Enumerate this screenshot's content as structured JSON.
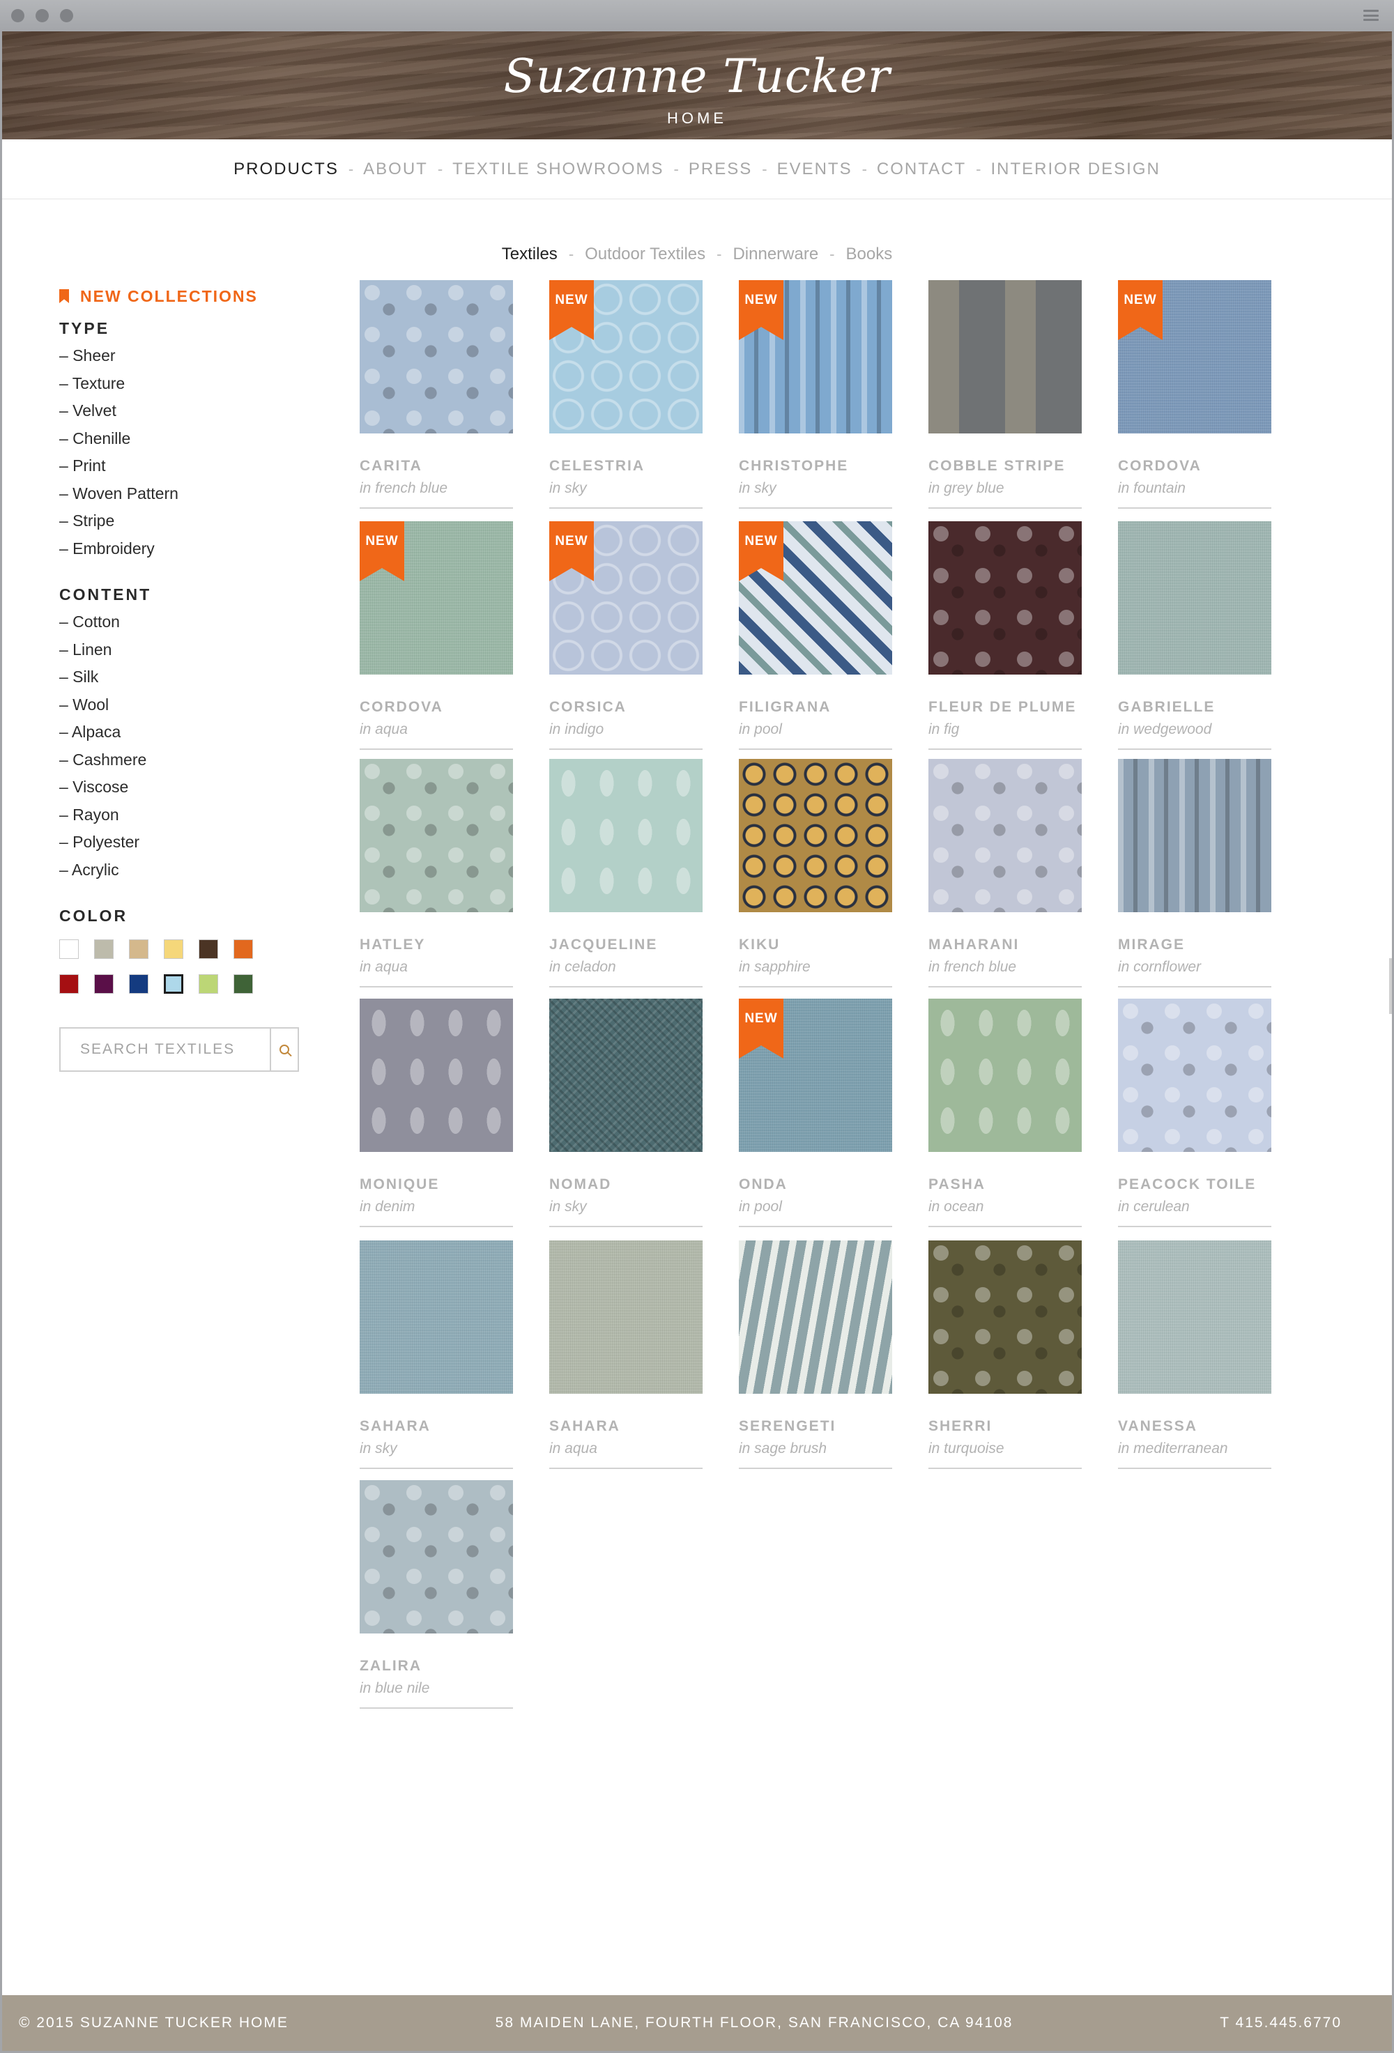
{
  "brand": {
    "script": "Suzanne Tucker",
    "sub": "HOME"
  },
  "nav": [
    {
      "label": "PRODUCTS",
      "active": true
    },
    {
      "label": "ABOUT"
    },
    {
      "label": "TEXTILE SHOWROOMS"
    },
    {
      "label": "PRESS"
    },
    {
      "label": "EVENTS"
    },
    {
      "label": "CONTACT"
    },
    {
      "label": "INTERIOR DESIGN"
    }
  ],
  "nav_separator": "-",
  "subnav": [
    {
      "label": "Textiles",
      "active": true
    },
    {
      "label": "Outdoor Textiles"
    },
    {
      "label": "Dinnerware"
    },
    {
      "label": "Books"
    }
  ],
  "sidebar": {
    "new_collections": "NEW COLLECTIONS",
    "type_heading": "TYPE",
    "types": [
      "– Sheer",
      "– Texture",
      "– Velvet",
      "– Chenille",
      "– Print",
      "– Woven Pattern",
      "– Stripe",
      "– Embroidery"
    ],
    "content_heading": "CONTENT",
    "contents": [
      "– Cotton",
      "– Linen",
      "– Silk",
      "– Wool",
      "– Alpaca",
      "– Cashmere",
      "– Viscose",
      "– Rayon",
      "– Polyester",
      "– Acrylic"
    ],
    "color_heading": "COLOR",
    "colors": [
      "#ffffff",
      "#bdbbab",
      "#d4b88c",
      "#f5d77a",
      "#4b3424",
      "#e2681e",
      "#a50f12",
      "#5a0f48",
      "#143b80",
      "#aed8ea",
      "#bcd676",
      "#3f6337"
    ],
    "selected_color_index": 9,
    "search_placeholder": "SEARCH TEXTILES"
  },
  "badge_label": "NEW",
  "products": [
    {
      "name": "CARITA",
      "color": "in french blue",
      "is_new": false,
      "swatch": "#a9bdd3",
      "pattern": "floral"
    },
    {
      "name": "CELESTRIA",
      "color": "in sky",
      "is_new": true,
      "swatch": "#a7cce0",
      "pattern": "medallion"
    },
    {
      "name": "CHRISTOPHE",
      "color": "in sky",
      "is_new": true,
      "swatch": "#7fa9cf",
      "pattern": "stripe"
    },
    {
      "name": "COBBLE STRIPE",
      "color": "in grey blue",
      "is_new": false,
      "swatch": "#6f7274",
      "pattern": "wide-stripe"
    },
    {
      "name": "CORDOVA",
      "color": "in fountain",
      "is_new": true,
      "swatch": "#7b98b8",
      "pattern": "texture"
    },
    {
      "name": "CORDOVA",
      "color": "in aqua",
      "is_new": true,
      "swatch": "#9ab7a6",
      "pattern": "texture"
    },
    {
      "name": "CORSICA",
      "color": "in indigo",
      "is_new": true,
      "swatch": "#b8c4da",
      "pattern": "medallion"
    },
    {
      "name": "FILIGRANA",
      "color": "in pool",
      "is_new": true,
      "swatch": "#5c7ea2",
      "pattern": "ikat"
    },
    {
      "name": "FLEUR DE PLUME",
      "color": "in fig",
      "is_new": false,
      "swatch": "#4a2a2c",
      "pattern": "floral"
    },
    {
      "name": "GABRIELLE",
      "color": "in wedgewood",
      "is_new": false,
      "swatch": "#9eb5b1",
      "pattern": "texture"
    },
    {
      "name": "HATLEY",
      "color": "in aqua",
      "is_new": false,
      "swatch": "#aec3b8",
      "pattern": "floral"
    },
    {
      "name": "JACQUELINE",
      "color": "in celadon",
      "is_new": false,
      "swatch": "#b3d0c8",
      "pattern": "damask"
    },
    {
      "name": "KIKU",
      "color": "in sapphire",
      "is_new": false,
      "swatch": "#b08a46",
      "pattern": "dots"
    },
    {
      "name": "MAHARANI",
      "color": "in french blue",
      "is_new": false,
      "swatch": "#c1c6d6",
      "pattern": "floral"
    },
    {
      "name": "MIRAGE",
      "color": "in cornflower",
      "is_new": false,
      "swatch": "#8ea1b3",
      "pattern": "stripe"
    },
    {
      "name": "MONIQUE",
      "color": "in denim",
      "is_new": false,
      "swatch": "#8f8f9c",
      "pattern": "damask"
    },
    {
      "name": "NOMAD",
      "color": "in sky",
      "is_new": false,
      "swatch": "#4d6b70",
      "pattern": "weave"
    },
    {
      "name": "ONDA",
      "color": "in pool",
      "is_new": true,
      "swatch": "#7c9fae",
      "pattern": "texture"
    },
    {
      "name": "PASHA",
      "color": "in ocean",
      "is_new": false,
      "swatch": "#9eb99a",
      "pattern": "damask"
    },
    {
      "name": "PEACOCK TOILE",
      "color": "in cerulean",
      "is_new": false,
      "swatch": "#c6d0e4",
      "pattern": "floral"
    },
    {
      "name": "SAHARA",
      "color": "in sky",
      "is_new": false,
      "swatch": "#8eabb6",
      "pattern": "texture"
    },
    {
      "name": "SAHARA",
      "color": "in aqua",
      "is_new": false,
      "swatch": "#b1b8aa",
      "pattern": "texture"
    },
    {
      "name": "SERENGETI",
      "color": "in sage brush",
      "is_new": false,
      "swatch": "#8ea4a8",
      "pattern": "zebra"
    },
    {
      "name": "SHERRI",
      "color": "in turquoise",
      "is_new": false,
      "swatch": "#5e5a3a",
      "pattern": "floral"
    },
    {
      "name": "VANESSA",
      "color": "in mediterranean",
      "is_new": false,
      "swatch": "#abbdbc",
      "pattern": "texture"
    },
    {
      "name": "ZALIRA",
      "color": "in blue nile",
      "is_new": false,
      "swatch": "#aebdc4",
      "pattern": "floral"
    }
  ],
  "footer": {
    "copyright": "© 2015 SUZANNE TUCKER HOME",
    "address": "58 MAIDEN LANE, FOURTH FLOOR, SAN FRANCISCO, CA 94108",
    "phone": "T 415.445.6770"
  }
}
